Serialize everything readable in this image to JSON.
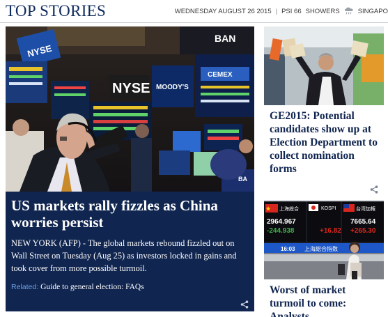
{
  "header": {
    "brand": "TOP STORIES",
    "date": "WEDNESDAY AUGUST 26 2015",
    "separator": "|",
    "psi": "PSI 66",
    "weather": "SHOWERS",
    "location": "SINGAPO"
  },
  "main_story": {
    "headline": "US markets rally fizzles as China worries persist",
    "dateline": "NEW YORK (AFP)",
    "summary": " - The global markets rebound fizzled out on Wall Street on Tuesday (Aug 25) as investors locked in gains and took cover from more possible turmoil.",
    "related_label": "Related:",
    "related_link": "Guide to general election: FAQs",
    "photo_signs": {
      "nyse_top": "NYSE",
      "nyse_main": "NYSE",
      "bank": "BAN",
      "moodys": "MOODY'S",
      "cemex": "CEMEX",
      "booth": "BA"
    }
  },
  "side_stories": [
    {
      "headline": "GE2015: Potential candidates show up at Election Department to collect nomination forms"
    },
    {
      "headline": "Worst of market turmoil to come: Analysts",
      "board": {
        "left_label": "上海総合",
        "left_value": "2964.967",
        "left_change": "-244.938",
        "mid_label": "KOSPI",
        "mid_change": "+16.82",
        "right_label": "台湾加権",
        "right_value": "7665.64",
        "right_change": "+265.30",
        "time": "16:03",
        "ticker": "上海総合指数"
      }
    }
  ],
  "colors": {
    "brand": "#0f2a5c",
    "main_panel": "#10254f",
    "related": "#6fa0e8"
  },
  "icons": {
    "weather": "rain-cloud-icon",
    "share": "share-icon"
  }
}
